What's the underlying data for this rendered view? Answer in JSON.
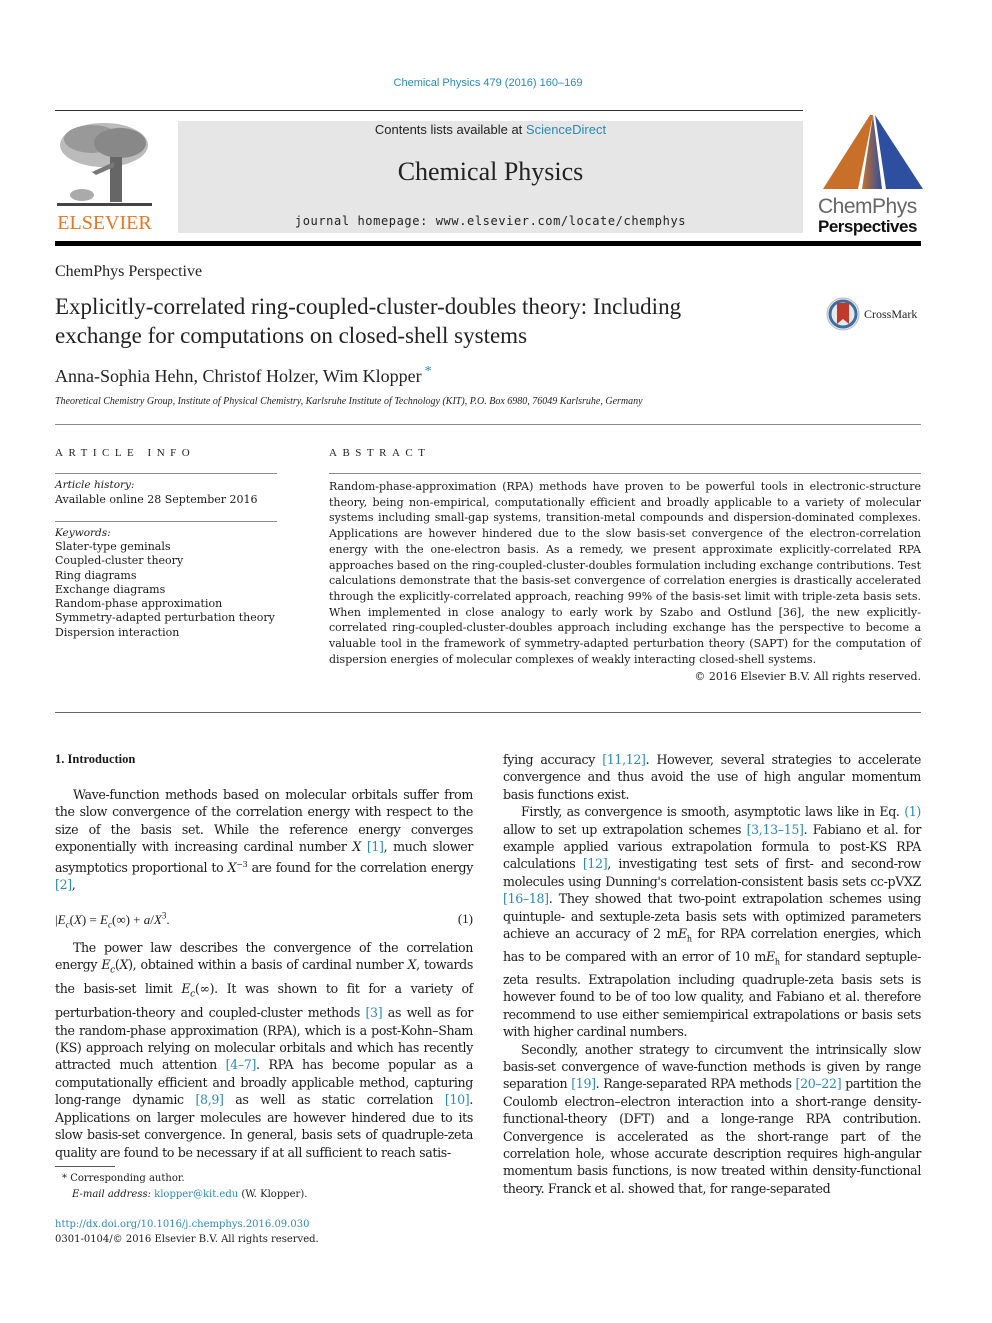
{
  "journal_ref": "Chemical Physics 479 (2016) 160–169",
  "header": {
    "publisher_logo": "ELSEVIER",
    "contents_prefix": "Contents lists available at ",
    "contents_link": "ScienceDirect",
    "journal_title": "Chemical Physics",
    "homepage_label": "journal homepage: www.elsevier.com/locate/chemphys",
    "series_logo_line1": "ChemPhys",
    "series_logo_line2": "Perspectives",
    "colors": {
      "elsevier_orange": "#e87722",
      "link_blue": "#2a8ab5",
      "logo_orange": "#c8702a",
      "logo_blue": "#2e4fa0",
      "banner_gray": "#e6e6e6"
    }
  },
  "article": {
    "type": "ChemPhys Perspective",
    "title_line1": "Explicitly-correlated ring-coupled-cluster-doubles theory: Including",
    "title_line2": "exchange for computations on closed-shell systems",
    "crossmark_label": "CrossMark",
    "authors": "Anna-Sophia Hehn, Christof Holzer, Wim Klopper",
    "author_mark": "*",
    "affiliation": "Theoretical Chemistry Group, Institute of Physical Chemistry, Karlsruhe Institute of Technology (KIT), P.O. Box 6980, 76049 Karlsruhe, Germany"
  },
  "article_info": {
    "heading": "ARTICLE INFO",
    "history_label": "Article history:",
    "history_value": "Available online 28 September 2016",
    "keywords_label": "Keywords:",
    "keywords": [
      "Slater-type geminals",
      "Coupled-cluster theory",
      "Ring diagrams",
      "Exchange diagrams",
      "Random-phase approximation",
      "Symmetry-adapted perturbation theory",
      "Dispersion interaction"
    ]
  },
  "abstract": {
    "heading": "ABSTRACT",
    "text": "Random-phase-approximation (RPA) methods have proven to be powerful tools in electronic-structure theory, being non-empirical, computationally efficient and broadly applicable to a variety of molecular systems including small-gap systems, transition-metal compounds and dispersion-dominated complexes. Applications are however hindered due to the slow basis-set convergence of the electron-correlation energy with the one-electron basis. As a remedy, we present approximate explicitly-correlated RPA approaches based on the ring-coupled-cluster-doubles formulation including exchange contributions. Test calculations demonstrate that the basis-set convergence of correlation energies is drastically accelerated through the explicitly-correlated approach, reaching 99% of the basis-set limit with triple-zeta basis sets. When implemented in close analogy to early work by Szabo and Ostlund [36], the new explicitly-correlated ring-coupled-cluster-doubles approach including exchange has the perspective to become a valuable tool in the framework of symmetry-adapted perturbation theory (SAPT) for the computation of dispersion energies of molecular complexes of weakly interacting closed-shell systems.",
    "copyright": "© 2016 Elsevier B.V. All rights reserved."
  },
  "intro": {
    "heading": "1. Introduction",
    "p1_a": "Wave-function methods based on molecular orbitals suffer from the slow convergence of the correlation energy with respect to the size of the basis set. While the reference energy converges exponentially with increasing cardinal number ",
    "p1_X": "X",
    "p1_ref1": "[1]",
    "p1_b": ", much slower asymptotics proportional to ",
    "p1_Xexp": "X",
    "p1_exp": "−3",
    "p1_c": " are found for the correlation energy ",
    "p1_ref2": "[2]",
    "p1_d": ",",
    "equation": "|E",
    "equation_full": "|Ec(X) = Ec(∞) + a/X3.",
    "equation_number": "(1)",
    "p2_a": "The power law describes the convergence of the correlation energy ",
    "p2_b": ", obtained within a basis of cardinal number ",
    "p2_c": ", towards the basis-set limit ",
    "p2_d": ". It was shown to fit for a variety of perturbation-theory and coupled-cluster methods ",
    "p2_ref3": "[3]",
    "p2_e": " as well as for the random-phase approximation (RPA), which is a post-Kohn–Sham (KS) approach relying on molecular orbitals and which has recently attracted much attention ",
    "p2_ref4": "[4–7]",
    "p2_f": ". RPA has become popular as a computationally efficient and broadly applicable method, capturing long-range dynamic ",
    "p2_ref8": "[8,9]",
    "p2_g": " as well as static correlation ",
    "p2_ref10": "[10]",
    "p2_h": ". Applications on larger molecules are however hindered due to its slow basis-set convergence. In general, basis sets of quadruple-zeta quality are found to be necessary if at all sufficient to reach satis-",
    "r1_a": "fying accuracy ",
    "r1_ref11": "[11,12]",
    "r1_b": ". However, several strategies to accelerate convergence and thus avoid the use of high angular momentum basis functions exist.",
    "r2_a": "Firstly, as convergence is smooth, asymptotic laws like in Eq. ",
    "r2_eqref": "(1)",
    "r2_b": " allow to set up extrapolation schemes ",
    "r2_ref3": "[3,13–15]",
    "r2_c": ". Fabiano et al. for example applied various extrapolation formula to post-KS RPA calculations ",
    "r2_ref12": "[12]",
    "r2_d": ", investigating test sets of first- and second-row molecules using Dunning's correlation-consistent basis sets cc-pVXZ ",
    "r2_ref16": "[16–18]",
    "r2_e": ". They showed that two-point extrapolation schemes using quintuple- and sextuple-zeta basis sets with optimized parameters achieve an accuracy of 2 m",
    "r2_f": " for RPA correlation energies, which has to be compared with an error of 10 m",
    "r2_g": " for standard septuple-zeta results. Extrapolation including quadruple-zeta basis sets is however found to be of too low quality, and Fabiano et al. therefore recommend to use either semiempirical extrapolations or basis sets with higher cardinal numbers.",
    "r3_a": "Secondly, another strategy to circumvent the intrinsically slow basis-set convergence of wave-function methods is given by range separation ",
    "r3_ref19": "[19]",
    "r3_b": ". Range-separated RPA methods ",
    "r3_ref20": "[20–22]",
    "r3_c": " partition the Coulomb electron–electron interaction into a short-range density-functional-theory (DFT) and a longe-range RPA contribution. Convergence is accelerated as the short-range part of the correlation hole, whose accurate description requires high-angular momentum basis functions, is now treated within density-functional theory. Franck et al. showed that, for range-separated"
  },
  "footnote": {
    "mark": "*",
    "corresponding": "Corresponding author.",
    "email_label": "E-mail address: ",
    "email": "klopper@kit.edu",
    "email_suffix": " (W. Klopper).",
    "doi": "http://dx.doi.org/10.1016/j.chemphys.2016.09.030",
    "issn": "0301-0104/© 2016 Elsevier B.V. All rights reserved."
  }
}
